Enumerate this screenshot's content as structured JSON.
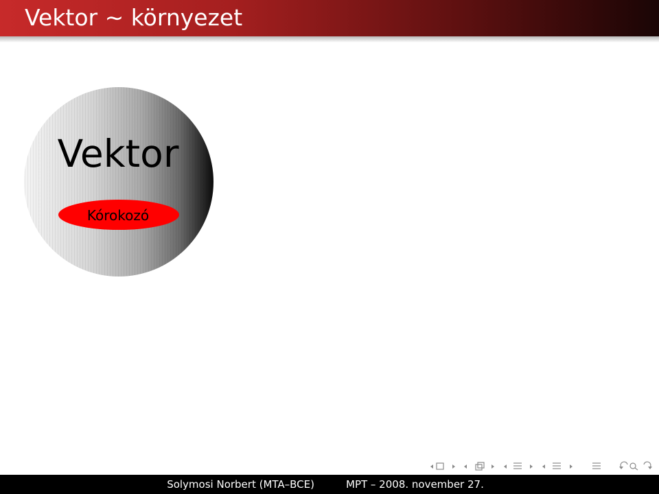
{
  "slide": {
    "title": "Vektor ∼ környezet"
  },
  "figure": {
    "outer_label": "Vektor",
    "inner_label": "Kórokozó",
    "outer_color_light": "#f2f2f2",
    "outer_color_dark": "#111111",
    "inner_color": "#ff0000"
  },
  "footer": {
    "author": "Solymosi Norbert (MTA–BCE)",
    "event": "MPT – 2008. november 27."
  },
  "navigation": {
    "icons": [
      "frame-back-icon",
      "frame-icon",
      "frame-forward-icon",
      "subsection-back-icon",
      "subsection-icon",
      "subsection-forward-icon",
      "section-back-icon",
      "section-icon",
      "section-forward-icon",
      "presentation-back-icon",
      "presentation-icon",
      "presentation-forward-icon",
      "toc-icon",
      "back-arrow-icon",
      "search-icon",
      "forward-arrow-icon"
    ]
  },
  "colors": {
    "title_bar_start": "#c72a2a",
    "title_bar_end": "#1a0505",
    "footer_left": "#000000",
    "footer_right": "#000000"
  }
}
